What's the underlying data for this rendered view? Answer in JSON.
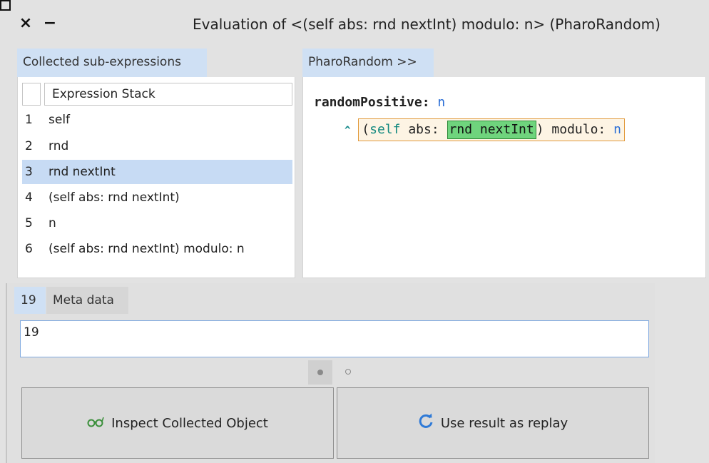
{
  "window": {
    "title": "Evaluation of <(self abs: rnd nextInt) modulo: n> (PharoRandom)",
    "close_glyph": "×",
    "minimize_glyph": "−"
  },
  "left_tab": {
    "label": "Collected sub-expressions"
  },
  "right_tab": {
    "label": "PharoRandom >>"
  },
  "table": {
    "header": "Expression Stack",
    "rows": [
      {
        "num": "1",
        "text": "self",
        "selected": false
      },
      {
        "num": "2",
        "text": "rnd",
        "selected": false
      },
      {
        "num": "3",
        "text": "rnd nextInt",
        "selected": true
      },
      {
        "num": "4",
        "text": "(self abs: rnd nextInt)",
        "selected": false
      },
      {
        "num": "5",
        "text": "n",
        "selected": false
      },
      {
        "num": "6",
        "text": "(self abs: rnd nextInt) modulo: n",
        "selected": false
      }
    ]
  },
  "code": {
    "selector": "randomPositive:",
    "arg": "n",
    "caret": "^",
    "open_paren": "(",
    "self_kw": "self",
    "abs_kw": " abs: ",
    "highlighted": "rnd nextInt",
    "close_rest": ") modulo: ",
    "last_arg": "n"
  },
  "bottom_tabs": {
    "value_tab": "19",
    "meta_tab": "Meta data"
  },
  "value_field": {
    "value": "19"
  },
  "buttons": {
    "inspect_label": "Inspect Collected Object",
    "replay_label": "Use result as replay",
    "inspect_icon": "glasses-icon",
    "replay_icon": "refresh-icon"
  },
  "colors": {
    "tab_active": "#cfe0f4",
    "selection": "#c7dbf4",
    "highlight_outer": "#e29a3c",
    "highlight_inner": "#6fd47d"
  }
}
